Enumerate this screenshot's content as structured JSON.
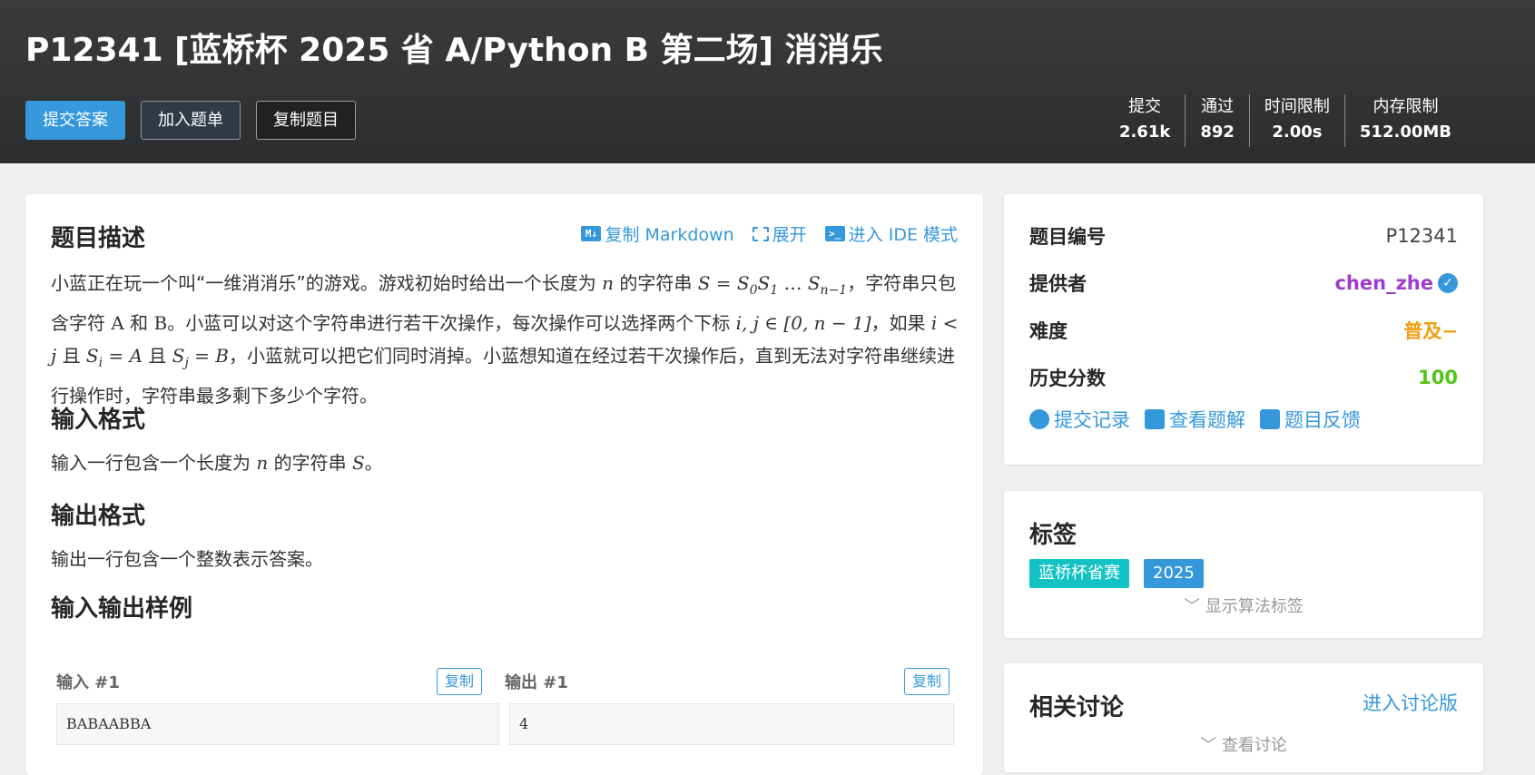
{
  "header": {
    "title": "P12341 [蓝桥杯 2025 省 A/Python B 第二场] 消消乐",
    "buttons": {
      "submit": "提交答案",
      "add": "加入题单",
      "copy": "复制题目"
    },
    "stats": [
      {
        "label": "提交",
        "value": "2.61k"
      },
      {
        "label": "通过",
        "value": "892"
      },
      {
        "label": "时间限制",
        "value": "2.00s"
      },
      {
        "label": "内存限制",
        "value": "512.00MB"
      }
    ]
  },
  "main": {
    "toolbar": {
      "markdown": "复制 Markdown",
      "expand": "展开",
      "ide": "进入 IDE 模式"
    },
    "desc_title": "题目描述",
    "desc_1": "小蓝正在玩一个叫“一维消消乐”的游戏。游戏初始时给出一个长度为",
    "desc_2": "的字符串",
    "desc_3": "，字符串只包含字符",
    "desc_4": "和",
    "desc_5": "。小蓝可以对这个字符串进行若干次操作，每次操作可以选择两个下标",
    "desc_6": "，如果",
    "desc_7": "且",
    "desc_8": "且",
    "desc_9": "，小蓝就可以把它们同时消掉。小蓝想知道在经过若干次操作后，直到无法对字符串继续进行操作时，字符串最多剩下多少个字符。",
    "input_title": "输入格式",
    "input_1": "输入一行包含一个长度为",
    "input_2": "的字符串",
    "input_3": "。",
    "output_title": "输出格式",
    "output_text": "输出一行包含一个整数表示答案。",
    "samples_title": "输入输出样例",
    "sample_in_label": "输入 #1",
    "sample_out_label": "输出 #1",
    "copy_label": "复制",
    "sample_in": "BABAABBA",
    "sample_out": "4"
  },
  "info": {
    "id_label": "题目编号",
    "id_value": "P12341",
    "provider_label": "提供者",
    "provider_value": "chen_zhe",
    "difficulty_label": "难度",
    "difficulty_value": "普及−",
    "score_label": "历史分数",
    "score_value": "100",
    "links": {
      "records": "提交记录",
      "solutions": "查看题解",
      "feedback": "题目反馈"
    }
  },
  "tags": {
    "title": "标签",
    "items": [
      "蓝桥杯省赛",
      "2025"
    ],
    "show_algo": "显示算法标签"
  },
  "discussion": {
    "title": "相关讨论",
    "enter": "进入讨论版",
    "view": "查看讨论"
  },
  "colors": {
    "accent": "#3498db",
    "provider": "#9d3dcf",
    "difficulty": "#f39c11",
    "score": "#52c41a",
    "tag1": "#13c2c2",
    "tag2": "#3498db"
  }
}
